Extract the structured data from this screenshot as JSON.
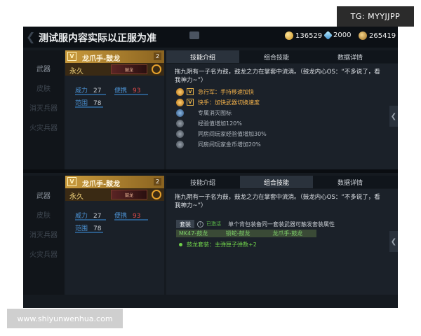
{
  "header": {
    "title": "测试服内容实际以正服为准",
    "currency": [
      {
        "icon": "gold-coin-icon",
        "value": "136529"
      },
      {
        "icon": "diamond-icon",
        "value": "2000"
      },
      {
        "icon": "medal-icon",
        "value": "265419"
      }
    ]
  },
  "watermarks": {
    "tg": "TG: MYYJJPP",
    "site": "www.shiyunwenhua.com"
  },
  "sidebar": {
    "items": [
      "武器",
      "皮肤",
      "消灭兵器",
      "火灾兵器"
    ]
  },
  "weapon": {
    "name": "龙爪手-鼓龙",
    "level": "2",
    "duration": "永久",
    "thumb_label": "鼓龙",
    "stats": [
      {
        "label": "威力",
        "value": "27"
      },
      {
        "label": "便携",
        "value": "93"
      },
      {
        "label": "范围",
        "value": "78"
      }
    ]
  },
  "tabs": [
    "技能介绍",
    "组合技能",
    "数据详情"
  ],
  "description": "拖九阴有一子名为鼓，鼓龙之力在掌套中流淌。（鼓龙内心OS：“不多说了，看我神力~”）",
  "skills": [
    {
      "text": "急行军：手持移速加快",
      "style": "orange"
    },
    {
      "text": "快手：加快武器切换速度",
      "style": "orange"
    },
    {
      "text": "专属消灭图标",
      "style": "gray"
    },
    {
      "text": "经验值增加120%",
      "style": "gray"
    },
    {
      "text": "同房间玩家经验值增加30%",
      "style": "gray"
    },
    {
      "text": "同房间玩家金币增加20%",
      "style": "gray"
    }
  ],
  "set": {
    "label": "套装",
    "status": "已激活",
    "desc": "单个背包装备同一套装武器可触发套装属性",
    "pieces": [
      "MK47-鼓龙",
      "锁蛇-鼓龙",
      "龙爪手-鼓龙"
    ],
    "bonus": "鼓龙套装：主弹匣子弹数+2"
  }
}
